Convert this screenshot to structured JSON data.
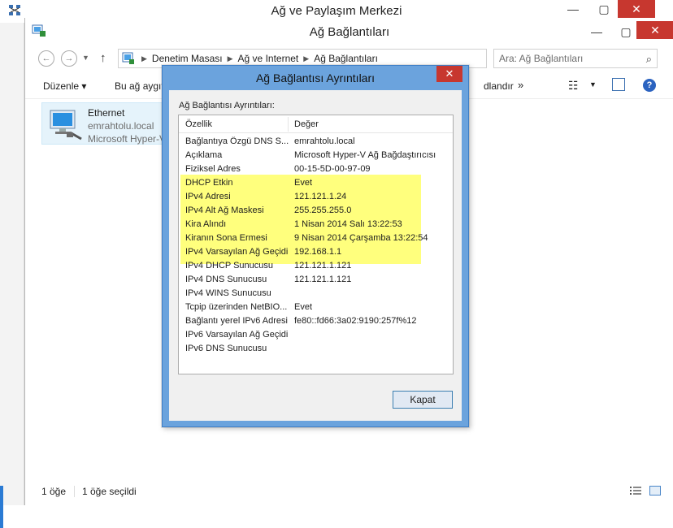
{
  "back_window": {
    "title": "Ağ ve Paylaşım Merkezi"
  },
  "explorer": {
    "title": "Ağ Bağlantıları",
    "address": {
      "crumbs": [
        "Denetim Masası",
        "Ağ ve Internet",
        "Ağ Bağlantıları"
      ]
    },
    "search": {
      "placeholder": "Ara: Ağ Bağlantıları"
    },
    "toolbar": {
      "organize": "Düzenle ▾",
      "connect": "Bu ağ aygıt",
      "trailing": "dlandır",
      "more": "»"
    },
    "item": {
      "name": "Ethernet",
      "domain": "emrahtolu.local",
      "device": "Microsoft Hyper-V"
    },
    "status": {
      "count": "1 öğe",
      "selected": "1 öğe seçildi"
    }
  },
  "dialog": {
    "title": "Ağ Bağlantısı Ayrıntıları",
    "caption": "Ağ Bağlantısı Ayrıntıları:",
    "columns": {
      "property": "Özellik",
      "value": "Değer"
    },
    "rows": [
      {
        "property": "Bağlantıya Özgü DNS S...",
        "value": "emrahtolu.local"
      },
      {
        "property": "Açıklama",
        "value": "Microsoft Hyper-V Ağ Bağdaştırıcısı"
      },
      {
        "property": "Fiziksel Adres",
        "value": "00-15-5D-00-97-09"
      },
      {
        "property": "DHCP Etkin",
        "value": "Evet"
      },
      {
        "property": "IPv4 Adresi",
        "value": "121.121.1.24"
      },
      {
        "property": "IPv4 Alt Ağ Maskesi",
        "value": "255.255.255.0"
      },
      {
        "property": "Kira Alındı",
        "value": "1 Nisan 2014 Salı 13:22:53"
      },
      {
        "property": "Kiranın Sona Ermesi",
        "value": "9 Nisan 2014 Çarşamba 13:22:54"
      },
      {
        "property": "IPv4 Varsayılan Ağ Geçidi",
        "value": "192.168.1.1"
      },
      {
        "property": "IPv4 DHCP Sunucusu",
        "value": "121.121.1.121"
      },
      {
        "property": "IPv4 DNS Sunucusu",
        "value": "121.121.1.121"
      },
      {
        "property": "IPv4 WINS Sunucusu",
        "value": ""
      },
      {
        "property": "Tcpip üzerinden NetBIO...",
        "value": "Evet"
      },
      {
        "property": "Bağlantı yerel IPv6 Adresi",
        "value": "fe80::fd66:3a02:9190:257f%12"
      },
      {
        "property": "IPv6 Varsayılan Ağ Geçidi",
        "value": ""
      },
      {
        "property": "IPv6 DNS Sunucusu",
        "value": ""
      }
    ],
    "close_label": "Kapat"
  },
  "colors": {
    "highlight": "#ffff66",
    "dialog_frame": "#6ba3dd",
    "close_red": "#c7372f"
  }
}
